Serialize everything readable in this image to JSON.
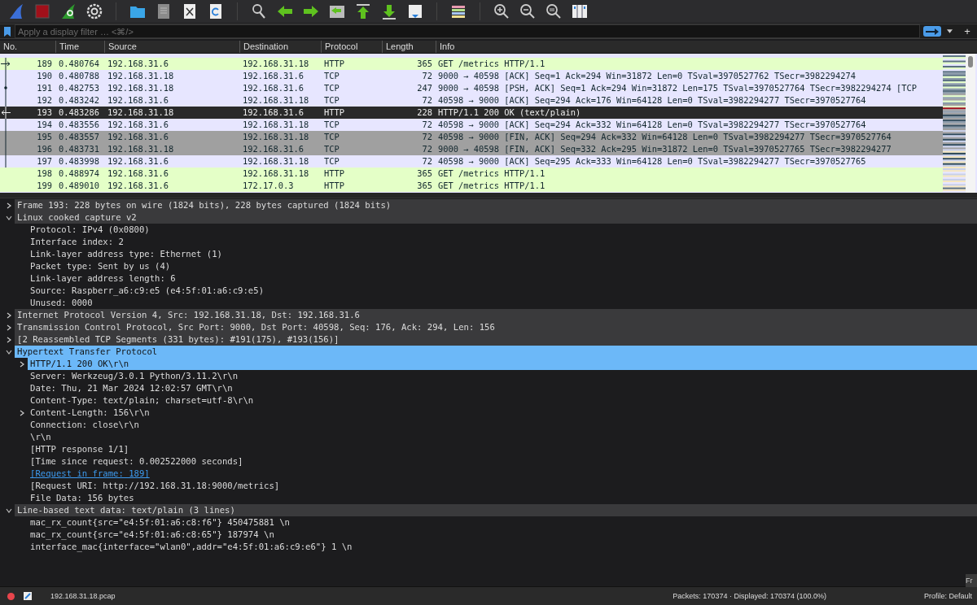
{
  "filter_bar": {
    "placeholder": "Apply a display filter … <⌘/>",
    "add_button": "+"
  },
  "packet_list": {
    "columns": [
      "No.",
      "Time",
      "Source",
      "Destination",
      "Protocol",
      "Length",
      "Info"
    ],
    "rows": [
      {
        "no": "189",
        "time": "0.480764",
        "source": "192.168.31.6",
        "destination": "192.168.31.18",
        "protocol": "HTTP",
        "length": "365",
        "info": "GET /metrics HTTP/1.1",
        "color": "#e4ffc7",
        "selected": false,
        "marker": {
          "kind": "request"
        },
        "in_conversation": true
      },
      {
        "no": "190",
        "time": "0.480788",
        "source": "192.168.31.18",
        "destination": "192.168.31.6",
        "protocol": "TCP",
        "length": "72",
        "info": "9000 → 40598 [ACK] Seq=1 Ack=294 Win=31872 Len=0 TSval=3970527762 TSecr=3982294274",
        "color": "#e7e6ff",
        "selected": false,
        "in_conversation": true
      },
      {
        "no": "191",
        "time": "0.482753",
        "source": "192.168.31.18",
        "destination": "192.168.31.6",
        "protocol": "TCP",
        "length": "247",
        "info": "9000 → 40598 [PSH, ACK] Seq=1 Ack=294 Win=31872 Len=175 TSval=3970527764 TSecr=3982294274 [TCP",
        "color": "#e7e6ff",
        "selected": false,
        "marker": {
          "kind": "segment"
        },
        "in_conversation": true
      },
      {
        "no": "192",
        "time": "0.483242",
        "source": "192.168.31.6",
        "destination": "192.168.31.18",
        "protocol": "TCP",
        "length": "72",
        "info": "40598 → 9000 [ACK] Seq=294 Ack=176 Win=64128 Len=0 TSval=3982294277 TSecr=3970527764",
        "color": "#e7e6ff",
        "selected": false,
        "in_conversation": true
      },
      {
        "no": "193",
        "time": "0.483286",
        "source": "192.168.31.18",
        "destination": "192.168.31.6",
        "protocol": "HTTP",
        "length": "228",
        "info": "HTTP/1.1 200 OK  (text/plain)",
        "selected": true,
        "marker": {
          "kind": "response"
        },
        "in_conversation": true
      },
      {
        "no": "194",
        "time": "0.483556",
        "source": "192.168.31.6",
        "destination": "192.168.31.18",
        "protocol": "TCP",
        "length": "72",
        "info": "40598 → 9000 [ACK] Seq=294 Ack=332 Win=64128 Len=0 TSval=3982294277 TSecr=3970527764",
        "color": "#e7e6ff",
        "selected": false,
        "in_conversation": true
      },
      {
        "no": "195",
        "time": "0.483557",
        "source": "192.168.31.6",
        "destination": "192.168.31.18",
        "protocol": "TCP",
        "length": "72",
        "info": "40598 → 9000 [FIN, ACK] Seq=294 Ack=332 Win=64128 Len=0 TSval=3982294277 TSecr=3970527764",
        "color": "#a0a0a0",
        "selected": false,
        "in_conversation": true
      },
      {
        "no": "196",
        "time": "0.483731",
        "source": "192.168.31.18",
        "destination": "192.168.31.6",
        "protocol": "TCP",
        "length": "72",
        "info": "9000 → 40598 [FIN, ACK] Seq=332 Ack=295 Win=31872 Len=0 TSval=3970527765 TSecr=3982294277",
        "color": "#a0a0a0",
        "selected": false,
        "in_conversation": true
      },
      {
        "no": "197",
        "time": "0.483998",
        "source": "192.168.31.6",
        "destination": "192.168.31.18",
        "protocol": "TCP",
        "length": "72",
        "info": "40598 → 9000 [ACK] Seq=295 Ack=333 Win=64128 Len=0 TSval=3982294277 TSecr=3970527765",
        "color": "#e7e6ff",
        "selected": false,
        "in_conversation": true
      },
      {
        "no": "198",
        "time": "0.488974",
        "source": "192.168.31.6",
        "destination": "192.168.31.18",
        "protocol": "HTTP",
        "length": "365",
        "info": "GET /metrics HTTP/1.1",
        "color": "#e4ffc7",
        "selected": false
      },
      {
        "no": "199",
        "time": "0.489010",
        "source": "192.168.31.6",
        "destination": "172.17.0.3",
        "protocol": "HTTP",
        "length": "365",
        "info": "GET /metrics HTTP/1.1",
        "color": "#e4ffc7",
        "selected": false
      }
    ]
  },
  "details": [
    {
      "text": "Frame 193: 228 bytes on wire (1824 bits), 228 bytes captured (1824 bits)",
      "expanded": false,
      "selected": false
    },
    {
      "text": "Linux cooked capture v2",
      "expanded": true,
      "selected": false,
      "children": [
        {
          "text": "Protocol: IPv4 (0x0800)"
        },
        {
          "text": "Interface index: 2"
        },
        {
          "text": "Link-layer address type: Ethernet (1)"
        },
        {
          "text": "Packet type: Sent by us (4)"
        },
        {
          "text": "Link-layer address length: 6"
        },
        {
          "text": "Source: Raspberr_a6:c9:e5 (e4:5f:01:a6:c9:e5)"
        },
        {
          "text": "Unused: 0000"
        }
      ]
    },
    {
      "text": "Internet Protocol Version 4, Src: 192.168.31.18, Dst: 192.168.31.6",
      "expanded": false,
      "selected": false
    },
    {
      "text": "Transmission Control Protocol, Src Port: 9000, Dst Port: 40598, Seq: 176, Ack: 294, Len: 156",
      "expanded": false,
      "selected": false
    },
    {
      "text": "[2 Reassembled TCP Segments (331 bytes): #191(175), #193(156)]",
      "expanded": false,
      "selected": false
    },
    {
      "text": "Hypertext Transfer Protocol",
      "expanded": true,
      "selected": true,
      "children": [
        {
          "text": "HTTP/1.1 200 OK\\r\\n",
          "expanded": false,
          "selected": true
        },
        {
          "text": "Server: Werkzeug/3.0.1 Python/3.11.2\\r\\n"
        },
        {
          "text": "Date: Thu, 21 Mar 2024 12:02:57 GMT\\r\\n"
        },
        {
          "text": "Content-Type: text/plain; charset=utf-8\\r\\n"
        },
        {
          "text": "Content-Length: 156\\r\\n",
          "expanded": false,
          "selected": false
        },
        {
          "text": "Connection: close\\r\\n"
        },
        {
          "text": "\\r\\n"
        },
        {
          "text": "[HTTP response 1/1]"
        },
        {
          "text": "[Time since request: 0.002522000 seconds]"
        },
        {
          "text": "[Request in frame: 189]",
          "kind": "link"
        },
        {
          "text": "[Request URI: http://192.168.31.18:9000/metrics]"
        },
        {
          "text": "File Data: 156 bytes"
        }
      ]
    },
    {
      "text": "Line-based text data: text/plain (3 lines)",
      "expanded": true,
      "selected": false,
      "children": [
        {
          "text": "mac_rx_count{src=\"e4:5f:01:a6:c8:f6\"} 450475881 \\n"
        },
        {
          "text": "mac_rx_count{src=\"e4:5f:01:a6:c8:65\"} 187974 \\n"
        },
        {
          "text": "interface_mac{interface=\"wlan0\",addr=\"e4:5f:01:a6:c9:e6\"} 1 \\n"
        }
      ]
    }
  ],
  "side_tab": "Fr",
  "status_bar": {
    "file": "192.168.31.18.pcap",
    "packets": "Packets: 170374 · Displayed: 170374 (100.0%)",
    "profile": "Profile: Default"
  }
}
